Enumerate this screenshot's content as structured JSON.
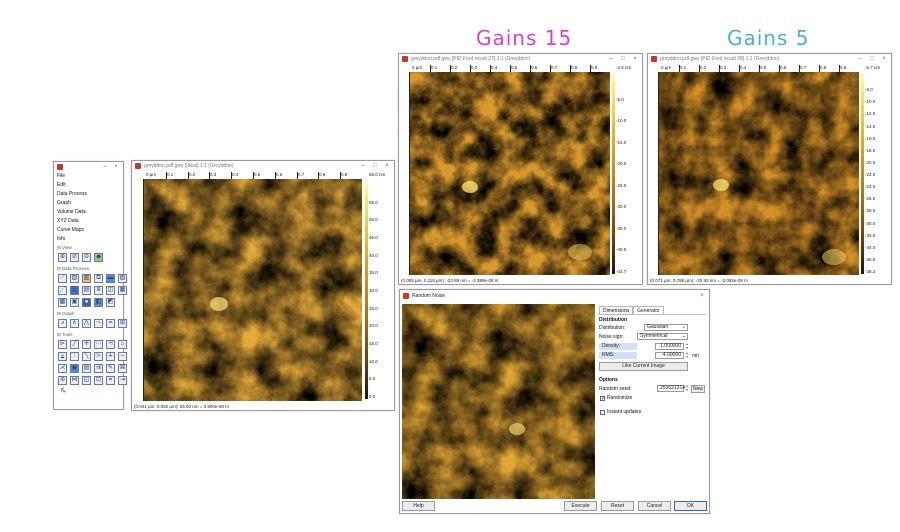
{
  "headings": {
    "gains15": "Gains  15",
    "gains5": "Gains  5",
    "gains15_color": "#d63fd2",
    "gains5_color": "#4aaee0"
  },
  "toolbox": {
    "menu": [
      "File",
      "Edit",
      "Data Process",
      "Graph",
      "Volume Data",
      "XYZ Data",
      "Curve Maps",
      "Info"
    ],
    "sections": {
      "view": "View",
      "data_process": "Data Process",
      "graph": "Graph",
      "tools": "Tools"
    }
  },
  "win_main": {
    "title": "greyddon.pdf.gwy [Ideal] 1:1 (Greyddon)",
    "status": "(0.041 µm, 0.092 µm): 26.00 nm = 3.900e-08 m",
    "ruler_unit": "0 µm",
    "ruler_ticks": [
      "0.1",
      "0.2",
      "0.3",
      "0.4",
      "0.5",
      "0.6",
      "0.7",
      "0.8",
      "0.9"
    ],
    "scale_top": "65.0 nm",
    "scale": [
      "55.0",
      "50.0",
      "45.0",
      "40.0",
      "35.0",
      "30.0",
      "25.0",
      "20.0",
      "15.0",
      "10.0",
      "5.0",
      "0.0"
    ]
  },
  "win_g15": {
    "title": "greyddon.pdf.gwy [PID Ford result 27] 1:1 (Greyddon)",
    "status": "(0.055 µm, 0.115 µm): -23.89 nm = -2.389e-08 m",
    "ruler_unit": "0 µm",
    "ruler_ticks": [
      "0.1",
      "0.2",
      "0.3",
      "0.4",
      "0.5",
      "0.6",
      "0.7",
      "0.8",
      "0.9"
    ],
    "scale_top": "-2.5 nm",
    "scale": [
      "-5.0",
      "-10.0",
      "-15.0",
      "-20.0",
      "-25.0",
      "-30.0",
      "-35.0",
      "-40.0",
      "-43.7"
    ]
  },
  "win_g5": {
    "title": "greyddon.pdf.gwy [PID Ford result 28] 1:1 (Greyddon)",
    "status": "(0.071 µm, 0.788 µm): -20.92 nm = -2.092e-08 m",
    "ruler_unit": "0 µm",
    "ruler_ticks": [
      "0.1",
      "0.2",
      "0.3",
      "0.4",
      "0.5",
      "0.6",
      "0.7",
      "0.8",
      "0.9"
    ],
    "scale_top": "-5.7 nm",
    "scale": [
      "-8.0",
      "-10.0",
      "-12.0",
      "-14.0",
      "-16.0",
      "-18.0",
      "-20.0",
      "-22.0",
      "-24.0",
      "-26.0",
      "-28.0",
      "-30.0",
      "-32.0",
      "-34.0",
      "-36.0",
      "-38.2"
    ]
  },
  "dialog": {
    "title": "Random Noise",
    "tabs": [
      "Dimensions",
      "Generator"
    ],
    "section_distribution": "Distribution",
    "distribution_label": "Distribution:",
    "distribution_value": "Gaussian",
    "noise_sign_label": "Noise sign:",
    "noise_sign_value": "Symmetrical",
    "density_label": "Density:",
    "density_value": "1.000000",
    "rms_label": "RMS:",
    "rms_value": "4.00000",
    "rms_unit": "nm",
    "like_current": "Like Current Image",
    "section_options": "Options",
    "random_seed_label": "Random seed:",
    "random_seed_value": "253621314",
    "new_button": "New",
    "randomize_label": "Randomize",
    "randomize_checked": true,
    "instant_updates_label": "Instant updates",
    "instant_updates_checked": false,
    "buttons": {
      "help": "Help",
      "execute": "Execute",
      "reset": "Reset",
      "cancel": "Cancel",
      "ok": "OK"
    }
  }
}
